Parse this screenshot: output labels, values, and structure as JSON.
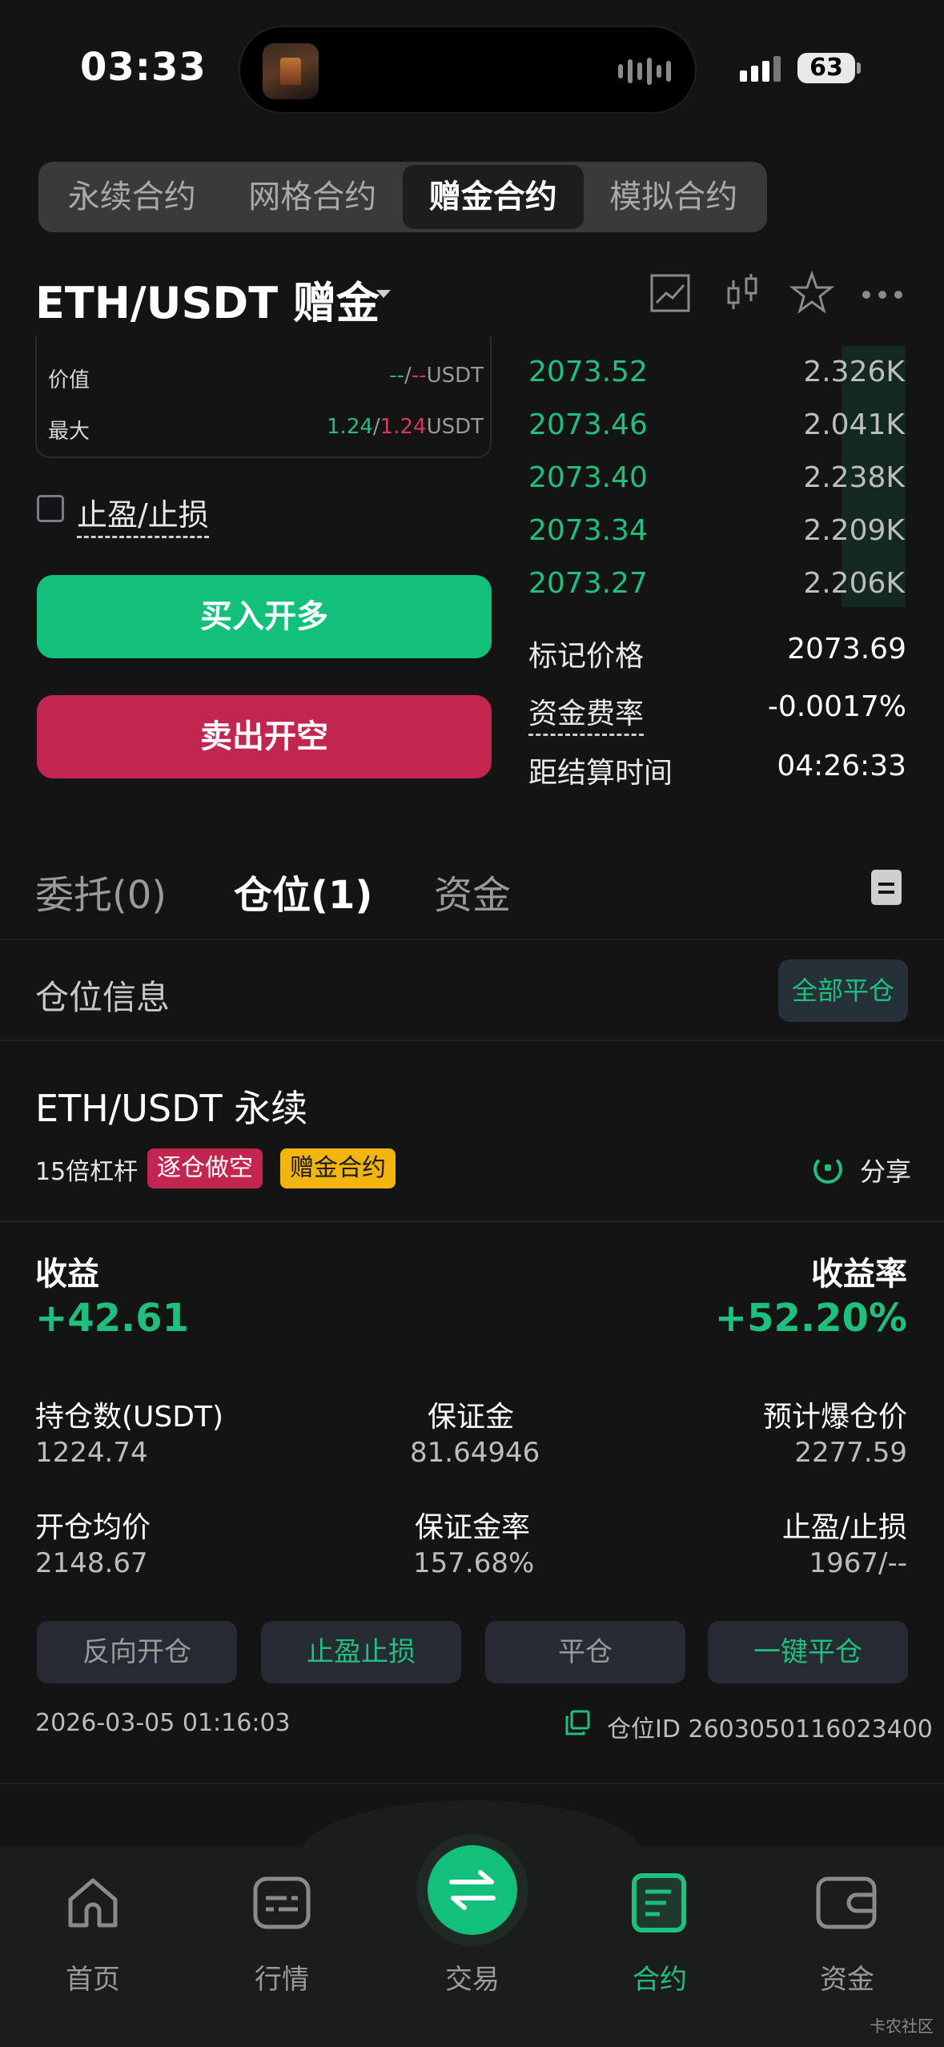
{
  "status_bar": {
    "time": "03:33",
    "battery": "63"
  },
  "contract_tabs": [
    "永续合约",
    "网格合约",
    "赠金合约",
    "模拟合约"
  ],
  "pair": {
    "name": "ETH/USDT 赠金"
  },
  "form": {
    "value_label": "价值",
    "value_long": "--",
    "value_sep": "/",
    "value_short": "--",
    "value_unit": "USDT",
    "max_label": "最大",
    "max_long": "1.24",
    "max_sep": "/",
    "max_short": "1.24",
    "max_unit": "USDT",
    "tpsl_label": "止盈/止损",
    "buy_label": "买入开多",
    "sell_label": "卖出开空"
  },
  "order_book": [
    {
      "price": "2073.52",
      "qty": "2.326K"
    },
    {
      "price": "2073.46",
      "qty": "2.041K"
    },
    {
      "price": "2073.40",
      "qty": "2.238K"
    },
    {
      "price": "2073.34",
      "qty": "2.209K"
    },
    {
      "price": "2073.27",
      "qty": "2.206K"
    }
  ],
  "market_info": {
    "mark_price_label": "标记价格",
    "mark_price": "2073.69",
    "funding_label": "资金费率",
    "funding": "-0.0017%",
    "settle_label": "距结算时间",
    "settle": "04:26:33"
  },
  "tabs": {
    "orders": "委托(0)",
    "positions": "仓位(1)",
    "funds": "资金"
  },
  "position_header": {
    "title": "仓位信息",
    "close_all": "全部平仓"
  },
  "position": {
    "symbol": "ETH/USDT 永续",
    "leverage": "15倍杠杆",
    "tag_side": "逐仓做空",
    "tag_type": "赠金合约",
    "share": "分享",
    "pnl_label": "收益",
    "pnl": "+42.61",
    "roe_label": "收益率",
    "roe": "+52.20%",
    "size_label": "持仓数(USDT)",
    "size": "1224.74",
    "margin_label": "保证金",
    "margin": "81.64946",
    "liq_label": "预计爆仓价",
    "liq": "2277.59",
    "entry_label": "开仓均价",
    "entry": "2148.67",
    "margin_rate_label": "保证金率",
    "margin_rate": "157.68%",
    "tpsl_label": "止盈/止损",
    "tpsl": "1967/--",
    "actions": [
      "反向开仓",
      "止盈止损",
      "平仓",
      "一键平仓"
    ],
    "timestamp": "2026-03-05 01:16:03",
    "id_label": "仓位ID 2603050116023400"
  },
  "nav": [
    "首页",
    "行情",
    "交易",
    "合约",
    "资金"
  ],
  "watermark": "卡农社区",
  "colors": {
    "green": "#12c07c",
    "red": "#c2254f",
    "yellow": "#f2b50f",
    "background": "#141414"
  }
}
